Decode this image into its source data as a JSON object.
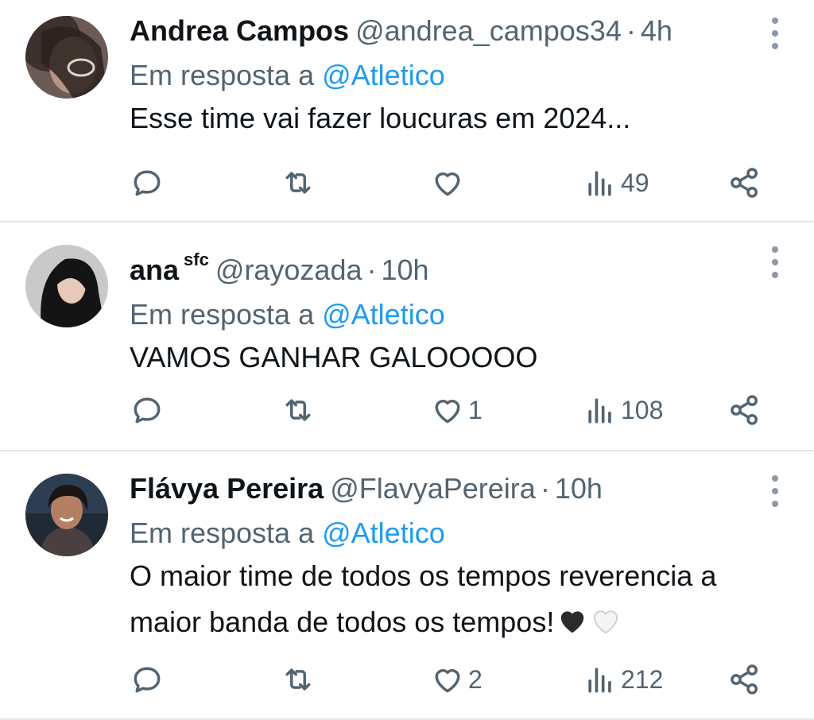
{
  "replies": [
    {
      "name": "Andrea Campos",
      "flair": "",
      "handle": "@andrea_campos34",
      "time": "4h",
      "reply_prefix": "Em resposta a",
      "reply_to": "@Atletico",
      "text_lines": [
        "Esse time vai fazer loucuras em 2024..."
      ],
      "likes": "",
      "views": "49"
    },
    {
      "name": "ana",
      "flair": "sfc",
      "handle": "@rayozada",
      "time": "10h",
      "reply_prefix": "Em resposta a",
      "reply_to": "@Atletico",
      "text_lines": [
        "VAMOS GANHAR GALOOOOO"
      ],
      "likes": "1",
      "views": "108"
    },
    {
      "name": "Flávya Pereira",
      "flair": "",
      "handle": "@FlavyaPereira",
      "time": "10h",
      "reply_prefix": "Em resposta a",
      "reply_to": "@Atletico",
      "text_lines": [
        "O maior time de todos os tempos reverencia a",
        "maior banda de todos os tempos!"
      ],
      "emoji": [
        "black-heart",
        "white-heart"
      ],
      "likes": "2",
      "views": "212"
    }
  ],
  "separator": "·",
  "colors": {
    "text": "#0f1419",
    "secondary": "#536471",
    "mention": "#1d9bf0",
    "divider": "#e7e9ea"
  },
  "icons": {
    "reply": "reply-icon",
    "retweet": "retweet-icon",
    "like": "heart-icon",
    "views": "views-icon",
    "share": "share-icon",
    "more": "more-vertical-icon"
  }
}
